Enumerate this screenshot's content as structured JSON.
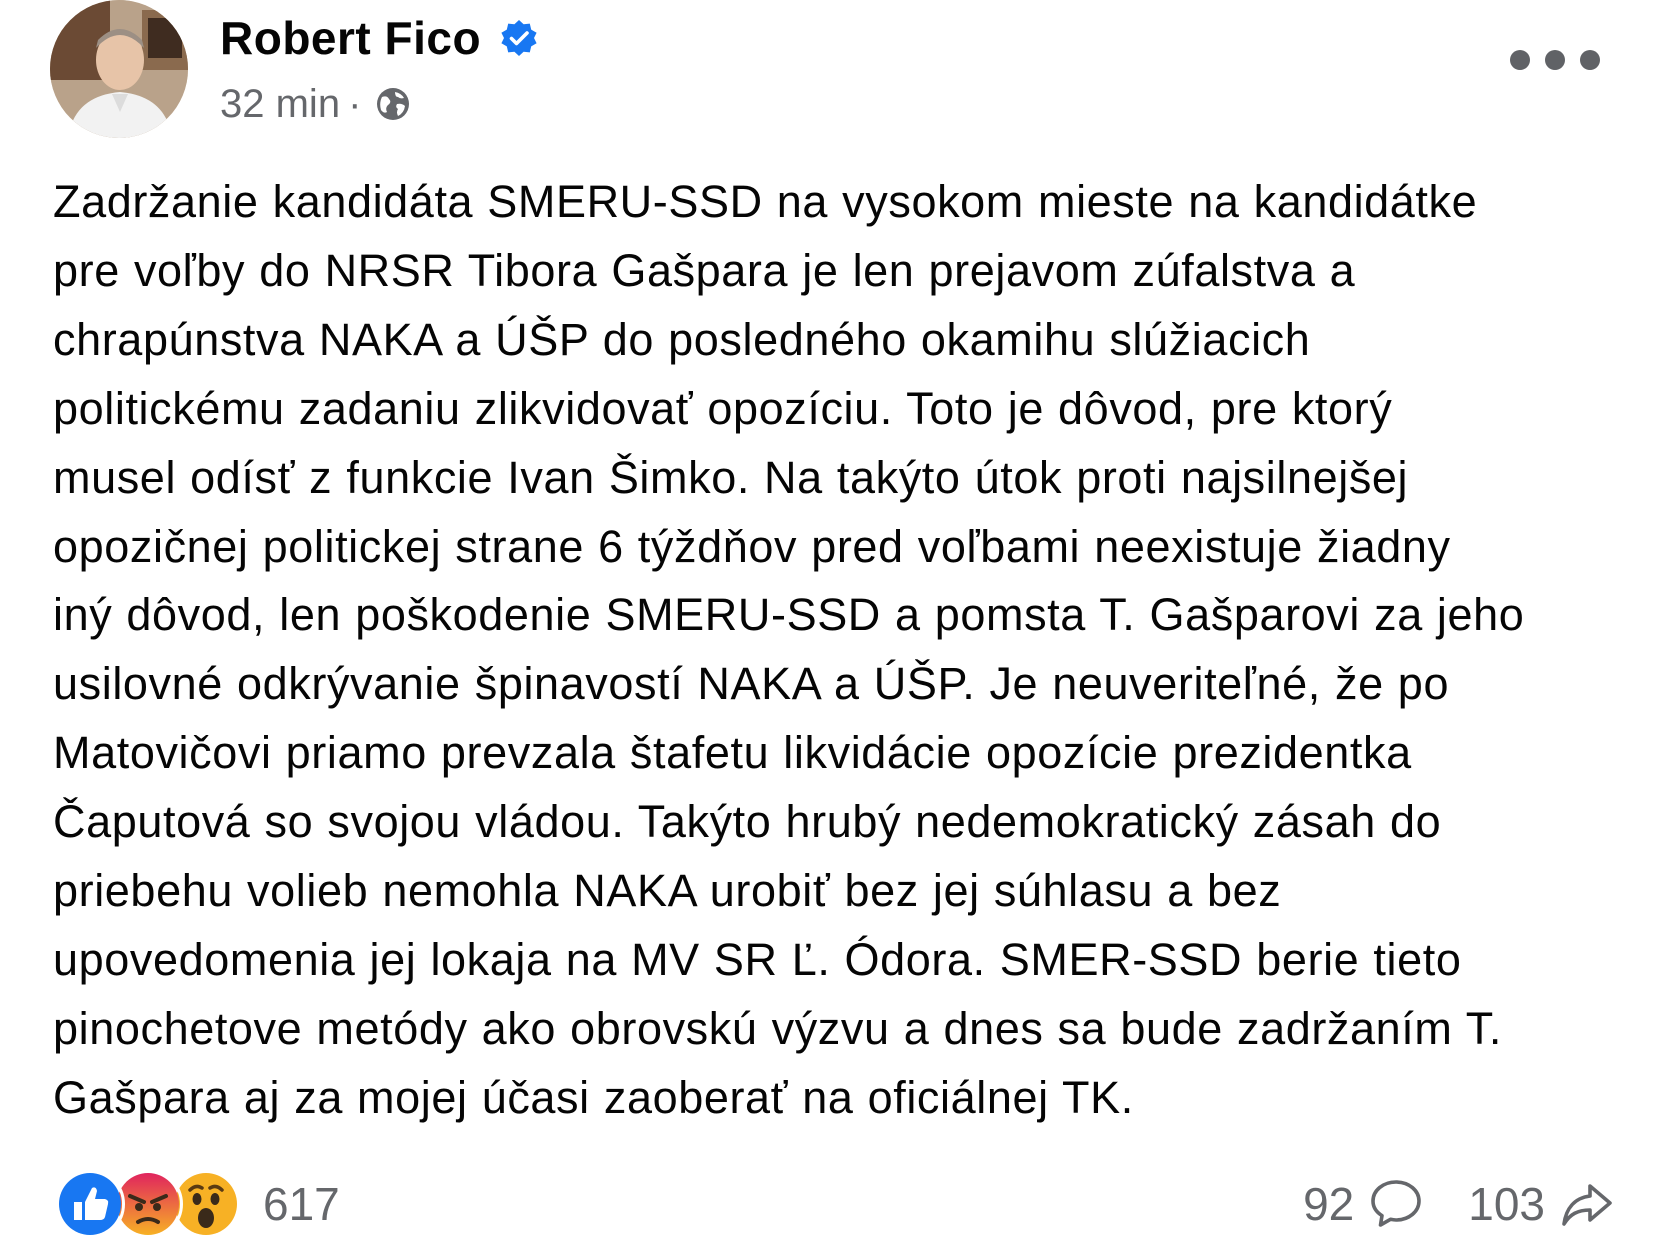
{
  "post": {
    "author": {
      "name": "Robert Fico",
      "verified": true,
      "avatar": "profile-photo"
    },
    "meta": {
      "time": "32 min",
      "separator": "·",
      "audience_icon": "globe-icon"
    },
    "more_icon": "more-options-icon",
    "text": "Zadržanie kandidáta SMERU-SSD na vysokom mieste na kandidátke\npre voľby do NRSR Tibora Gašpara je len prejavom zúfalstva a\nchrapúnstva NAKA a ÚŠP do posledného okamihu slúžiacich\npolitickému zadaniu zlikvidovať opozíciu. Toto je dôvod, pre ktorý\nmusel odísť z funkcie Ivan Šimko. Na takýto útok proti najsilnejšej\nopozičnej politickej strane 6 týždňov pred voľbami neexistuje žiadny\niný dôvod, len poškodenie SMERU-SSD a pomsta T. Gašparovi za jeho\nusilovné odkrývanie špinavostí NAKA a ÚŠP. Je neuveriteľné, že po\nMatovičovi priamo prevzala štafetu likvidácie opozície prezidentka\nČaputová so svojou vládou. Takýto hrubý nedemokratický zásah do\npriebehu volieb nemohla NAKA urobiť bez jej súhlasu a bez\nupovedomenia jej lokaja na MV SR Ľ. Ódora. SMER-SSD berie tieto\npinochetove metódy ako obrovskú výzvu a dnes sa bude zadržaním T.\nGašpara aj za mojej účasi zaoberať na oficiálnej TK.",
    "reactions": {
      "icons": [
        "like-icon",
        "angry-icon",
        "wow-icon"
      ],
      "count": "617"
    },
    "comments": {
      "count": "92",
      "icon": "comment-icon"
    },
    "shares": {
      "count": "103",
      "icon": "share-icon"
    }
  },
  "colors": {
    "text": "#050505",
    "secondary_text": "#65676b",
    "verified_blue": "#1877f2",
    "like_blue": "#1877f2",
    "angry_orange": "#e9710f",
    "wow_yellow": "#f7b125"
  }
}
